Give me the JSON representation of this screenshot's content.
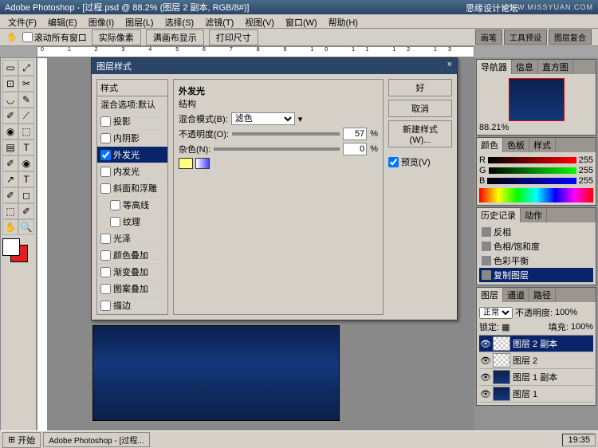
{
  "app": {
    "title": "Adobe Photoshop - [过程.psd @ 88.2% (图层 2 副本, RGB/8#)]"
  },
  "watermark": {
    "left": "思缘设计论坛",
    "right": "WWW.MISSYUAN.COM"
  },
  "menu": [
    "文件(F)",
    "编辑(E)",
    "图像(I)",
    "图层(L)",
    "选择(S)",
    "滤镜(T)",
    "视图(V)",
    "窗口(W)",
    "帮助(H)"
  ],
  "optbar": {
    "chk": "滚动所有窗口",
    "btns": [
      "实际像素",
      "满画布显示",
      "打印尺寸"
    ],
    "tabs": [
      "画笔",
      "工具预设",
      "图层复合"
    ]
  },
  "dialog": {
    "title": "图层样式",
    "styles_hdr": "样式",
    "blend_defaults": "混合选项:默认",
    "styles": [
      "投影",
      "内阴影",
      "外发光",
      "内发光",
      "斜面和浮雕",
      "等高线",
      "纹理",
      "光泽",
      "颜色叠加",
      "渐变叠加",
      "图案叠加",
      "描边"
    ],
    "styles_checked": [
      false,
      false,
      true,
      false,
      false,
      false,
      false,
      false,
      false,
      false,
      false,
      false
    ],
    "selected_index": 2,
    "section_title": "外发光",
    "struct_label": "结构",
    "blend_mode_label": "混合模式(B):",
    "blend_mode_value": "滤色",
    "opacity_label": "不透明度(O):",
    "opacity_value": "57",
    "noise_label": "杂色(N):",
    "noise_value": "0",
    "pct": "%",
    "ok": "好",
    "cancel": "取消",
    "newstyle": "新建样式(W)...",
    "preview": "预览(V)"
  },
  "nav": {
    "tabs": [
      "导航器",
      "信息",
      "直方图"
    ],
    "zoom": "88.21%"
  },
  "color": {
    "tabs": [
      "颜色",
      "色板",
      "样式"
    ],
    "r": "255",
    "g": "255",
    "b": "255",
    "R": "R",
    "G": "G",
    "B": "B"
  },
  "history": {
    "tabs": [
      "历史记录",
      "动作"
    ],
    "items": [
      "反相",
      "色相/饱和度",
      "色彩平衡",
      "复制图层"
    ],
    "selected_index": 3
  },
  "layers": {
    "tabs": [
      "图层",
      "通道",
      "路径"
    ],
    "mode": "正常",
    "opacity_label": "不透明度:",
    "opacity": "100%",
    "lock_label": "锁定:",
    "fill_label": "填充:",
    "fill": "100%",
    "items": [
      "图层 2 副本",
      "图层 2",
      "图层 1 副本",
      "图层 1"
    ],
    "selected_index": 0
  },
  "taskbar": {
    "start": "开始",
    "tasks": [
      "Adobe Photoshop - [过程..."
    ],
    "time": "19:35"
  },
  "tools": [
    "▭",
    "⤢",
    "⊡",
    "✂",
    "◡",
    "✎",
    "✐",
    "⟋",
    "◉",
    "⬚",
    "▤",
    "T",
    "↗",
    "◻",
    "🔍",
    "✋",
    "⬛",
    "Q"
  ]
}
